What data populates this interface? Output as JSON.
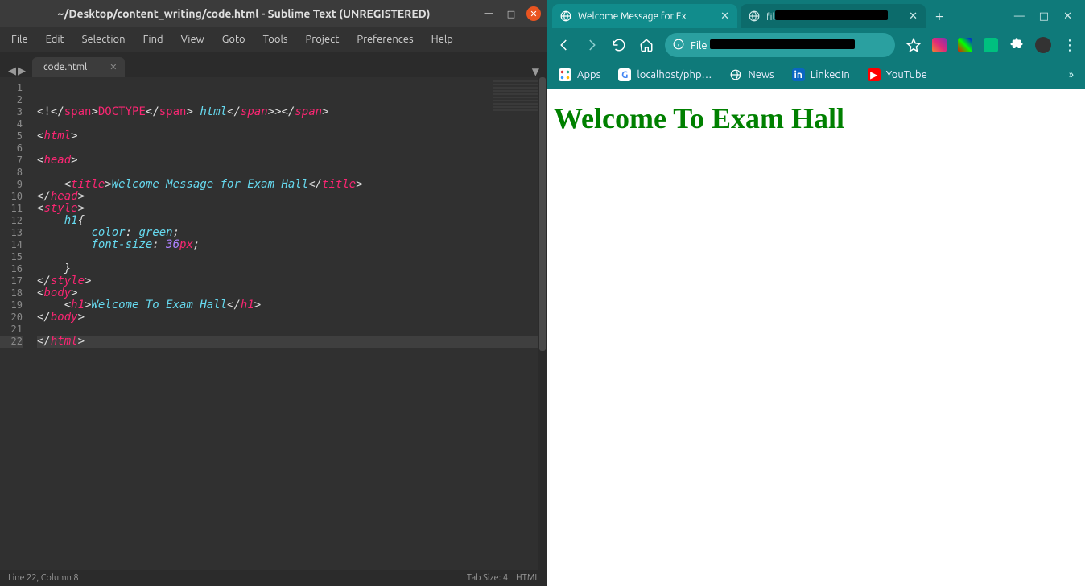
{
  "sublime": {
    "title": "~/Desktop/content_writing/code.html - Sublime Text (UNREGISTERED)",
    "menu": [
      "File",
      "Edit",
      "Selection",
      "Find",
      "View",
      "Goto",
      "Tools",
      "Project",
      "Preferences",
      "Help"
    ],
    "tab_name": "code.html",
    "status_left": "Line 22, Column 8",
    "status_mid": "Tab Size: 4",
    "status_right": "HTML",
    "code": {
      "lines": [
        "",
        "",
        "<!DOCTYPE html>",
        "",
        "<html>",
        "",
        "<head>",
        "",
        "    <title>Welcome Message for Exam Hall</title>",
        "</head>",
        "<style>",
        "    h1{",
        "        color: green;",
        "        font-size:36px;",
        "",
        "    }",
        "</style>",
        "<body>",
        "    <h1>Welcome To Exam Hall</h1>",
        "</body>",
        "",
        "</html>"
      ],
      "current_line": 22
    }
  },
  "chrome": {
    "tabs": [
      {
        "title": "Welcome Message for Ex",
        "active": true
      },
      {
        "title": "fil",
        "active": false
      }
    ],
    "address_prefix": "File",
    "address_vis": "…",
    "bookmarks": [
      {
        "icon": "apps",
        "label": "Apps"
      },
      {
        "icon": "g",
        "label": "localhost/php…"
      },
      {
        "icon": "globe",
        "label": "News"
      },
      {
        "icon": "in",
        "label": "LinkedIn"
      },
      {
        "icon": "yt",
        "label": "YouTube"
      }
    ],
    "page_heading": "Welcome To Exam Hall"
  }
}
